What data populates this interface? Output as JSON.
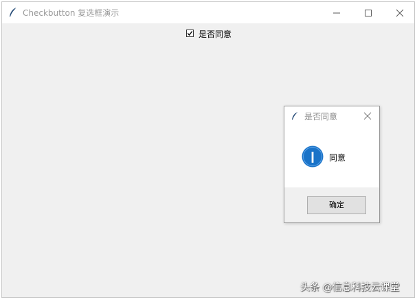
{
  "window": {
    "title": "Checkbutton 复选框演示",
    "icons": {
      "app": "feather-icon",
      "minimize": "minimize-icon",
      "maximize": "maximize-icon",
      "close": "close-icon"
    }
  },
  "checkbox": {
    "label": "是否同意",
    "checked": true
  },
  "dialog": {
    "title": "是否同意",
    "message": "同意",
    "ok_label": "确定",
    "icons": {
      "app": "feather-icon",
      "close": "close-icon",
      "message": "info-icon"
    }
  },
  "watermark": "头条 @信息科技云课堂",
  "colors": {
    "window_bg": "#f0f0f0",
    "info_blue": "#1a73c8",
    "button_bg": "#e1e1e1"
  }
}
